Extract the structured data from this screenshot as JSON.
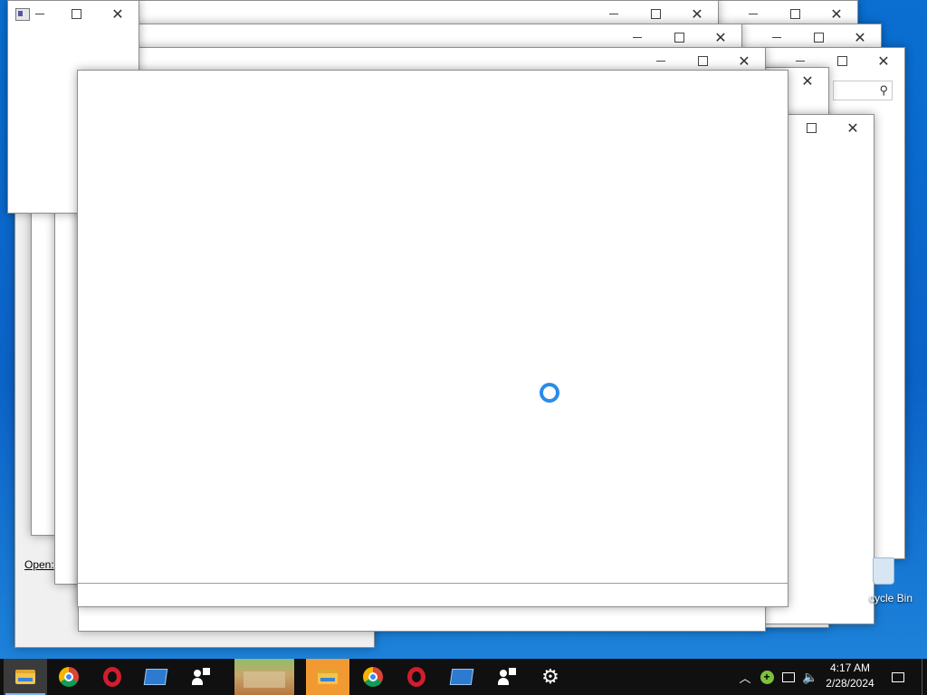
{
  "desktop": {
    "background_color": "#0b62c7",
    "recycle_bin_label": "cycle Bin"
  },
  "windows": [
    {
      "id": "w-topleft-small",
      "controls": [
        "minimize",
        "maximize",
        "close"
      ],
      "has_app_icon": true
    },
    {
      "id": "w-back-1",
      "controls": [
        "minimize",
        "maximize",
        "close"
      ]
    },
    {
      "id": "w-back-2",
      "controls": [
        "minimize",
        "maximize",
        "close"
      ]
    },
    {
      "id": "w-back-3",
      "controls": [
        "minimize",
        "maximize",
        "close"
      ]
    },
    {
      "id": "w-right-1",
      "controls": [
        "minimize",
        "maximize",
        "close"
      ]
    },
    {
      "id": "w-right-2",
      "controls": [
        "minimize",
        "maximize",
        "close"
      ]
    },
    {
      "id": "w-right-3",
      "controls": [
        "minimize",
        "maximize",
        "close"
      ],
      "search_icon": "search-icon"
    },
    {
      "id": "w-right-4",
      "controls": [
        "close"
      ]
    },
    {
      "id": "w-right-5",
      "controls": [
        "maximize",
        "close"
      ]
    },
    {
      "id": "w-front",
      "controls": [],
      "loading": true
    }
  ],
  "dialog": {
    "open_label": "Open:"
  },
  "taskbar": {
    "items": [
      {
        "name": "file-explorer",
        "icon": "folder-icon",
        "state": "active"
      },
      {
        "name": "chrome",
        "icon": "chrome-icon"
      },
      {
        "name": "opera",
        "icon": "opera-icon"
      },
      {
        "name": "app-card",
        "icon": "card-icon"
      },
      {
        "name": "people-app",
        "icon": "people-icon"
      },
      {
        "name": "photo-thumbnail",
        "icon": "photo-icon"
      },
      {
        "name": "file-explorer-2",
        "icon": "folder-icon",
        "state": "highlighted"
      },
      {
        "name": "chrome-2",
        "icon": "chrome-icon"
      },
      {
        "name": "opera-2",
        "icon": "opera-icon"
      },
      {
        "name": "app-card-2",
        "icon": "card-icon"
      },
      {
        "name": "people-app-2",
        "icon": "people-icon"
      },
      {
        "name": "settings",
        "icon": "gear-icon"
      }
    ],
    "tray": {
      "chevron_icon": "chevron-up-icon",
      "app_icon": "plus-badge-icon",
      "network_icon": "network-icon",
      "volume_icon": "volume-muted-icon"
    },
    "clock": {
      "time": "4:17 AM",
      "date": "2/28/2024"
    },
    "notification_icon": "notification-icon"
  }
}
